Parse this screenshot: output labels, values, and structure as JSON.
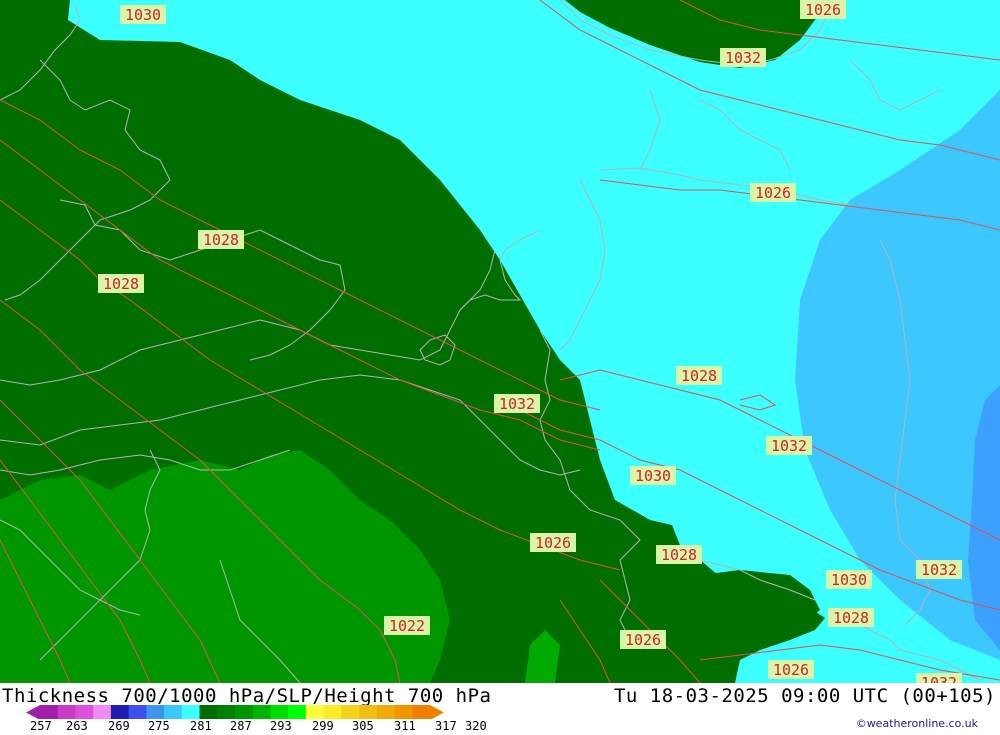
{
  "map": {
    "fields": {
      "land_dark": "#006e00",
      "land_mid": "#009600",
      "land_light": "#00aa00",
      "sea_cyan": "#3cffff",
      "sea_blue1": "#3cc8ff",
      "sea_blue2": "#3ca0ff"
    },
    "isobar_color": "#e05050",
    "coast_color": "#b4b4b4",
    "label_bg": "#d8f5a8",
    "isobar_labels": [
      "1030",
      "1026",
      "1028",
      "1032",
      "1028",
      "1026",
      "1032",
      "1028",
      "1032",
      "1030",
      "1026",
      "1028",
      "1032",
      "1030",
      "1028",
      "1022",
      "1026",
      "1026",
      "1032"
    ]
  },
  "footer": {
    "title": "Thickness 700/1000 hPa/SLP/Height 700 hPa",
    "datetime": "Tu 18-03-2025 09:00 UTC (00+105)",
    "credit": "©weatheronline.co.uk",
    "legend": {
      "labels": [
        "257",
        "263",
        "269",
        "275",
        "281",
        "287",
        "293",
        "299",
        "305",
        "311",
        "317",
        "320"
      ],
      "colors": [
        "#a01eaa",
        "#c83cc8",
        "#dc50dc",
        "#f08cf0",
        "#1e1eb4",
        "#3c50f0",
        "#3c96f0",
        "#3cc8ff",
        "#3cffff",
        "#006e00",
        "#008200",
        "#009600",
        "#00b400",
        "#00dc00",
        "#00ff00",
        "#ffff3c",
        "#ffeb28",
        "#f5d21e",
        "#f0be14",
        "#f0aa0a",
        "#f09600",
        "#f08200"
      ]
    }
  }
}
